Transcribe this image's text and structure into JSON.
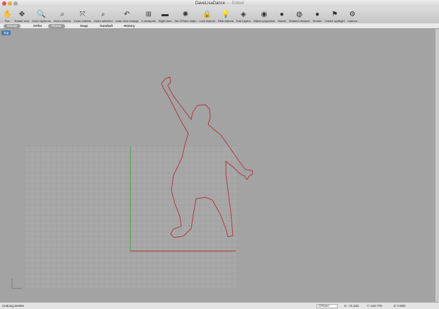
{
  "window": {
    "title": "DaveLisaDance",
    "edited": "— Edited"
  },
  "toolbar": [
    {
      "label": "Pan",
      "icon": "hand-icon",
      "glyph": "✋"
    },
    {
      "label": "Rotate view",
      "icon": "rotate-icon",
      "glyph": "✥"
    },
    {
      "label": "Zoom dynamic",
      "icon": "zoom-icon",
      "glyph": "🔍"
    },
    {
      "label": "Zoom window",
      "icon": "zoom-window-icon",
      "glyph": "⌕"
    },
    {
      "label": "Zoom extents",
      "icon": "zoom-extents-icon",
      "glyph": "⤧"
    },
    {
      "label": "Zoom selected",
      "icon": "zoom-selected-icon",
      "glyph": "⌕"
    },
    {
      "label": "Undo view change",
      "icon": "undo-view-icon",
      "glyph": "↶"
    },
    {
      "label": "4 viewports",
      "icon": "grid-icon",
      "glyph": "⊞"
    },
    {
      "label": "Right view",
      "icon": "car-icon",
      "glyph": "▬"
    },
    {
      "label": "Set CPlane origin",
      "icon": "cplane-icon",
      "glyph": "✺"
    },
    {
      "label": "Lock objects",
      "icon": "lock-icon",
      "glyph": "🔒"
    },
    {
      "label": "Hide objects",
      "icon": "bulb-icon",
      "glyph": "💡"
    },
    {
      "label": "Edit Layers",
      "icon": "layers-icon",
      "glyph": "◈"
    },
    {
      "label": "Object properties",
      "icon": "color-wheel-icon",
      "glyph": "◉"
    },
    {
      "label": "Shade",
      "icon": "sphere-icon",
      "glyph": "●"
    },
    {
      "label": "Shaded viewport",
      "icon": "shaded-icon",
      "glyph": "◍"
    },
    {
      "label": "Render",
      "icon": "render-sphere-icon",
      "glyph": "●"
    },
    {
      "label": "Create spotlight",
      "icon": "spotlight-icon",
      "glyph": "⚑"
    },
    {
      "label": "Options",
      "icon": "gear-icon",
      "glyph": "⚙"
    }
  ],
  "tabs": [
    {
      "label": "Osnap",
      "active": true
    },
    {
      "label": "Ortho",
      "active": false
    },
    {
      "label": "Planar",
      "active": true
    },
    {
      "label": "Snap",
      "active": false
    },
    {
      "label": "Gumball",
      "active": false
    },
    {
      "label": "History",
      "active": false
    }
  ],
  "viewport": {
    "label": "Top",
    "curve_color": "#b0303a",
    "x_axis_color": "#b03030",
    "y_axis_color": "#3fae3f"
  },
  "status": {
    "message": "Undoing Delete",
    "cplane": "CPlane",
    "x": "X: -71.842",
    "y": "Y: 142.776",
    "z": "Z: 0.000"
  }
}
